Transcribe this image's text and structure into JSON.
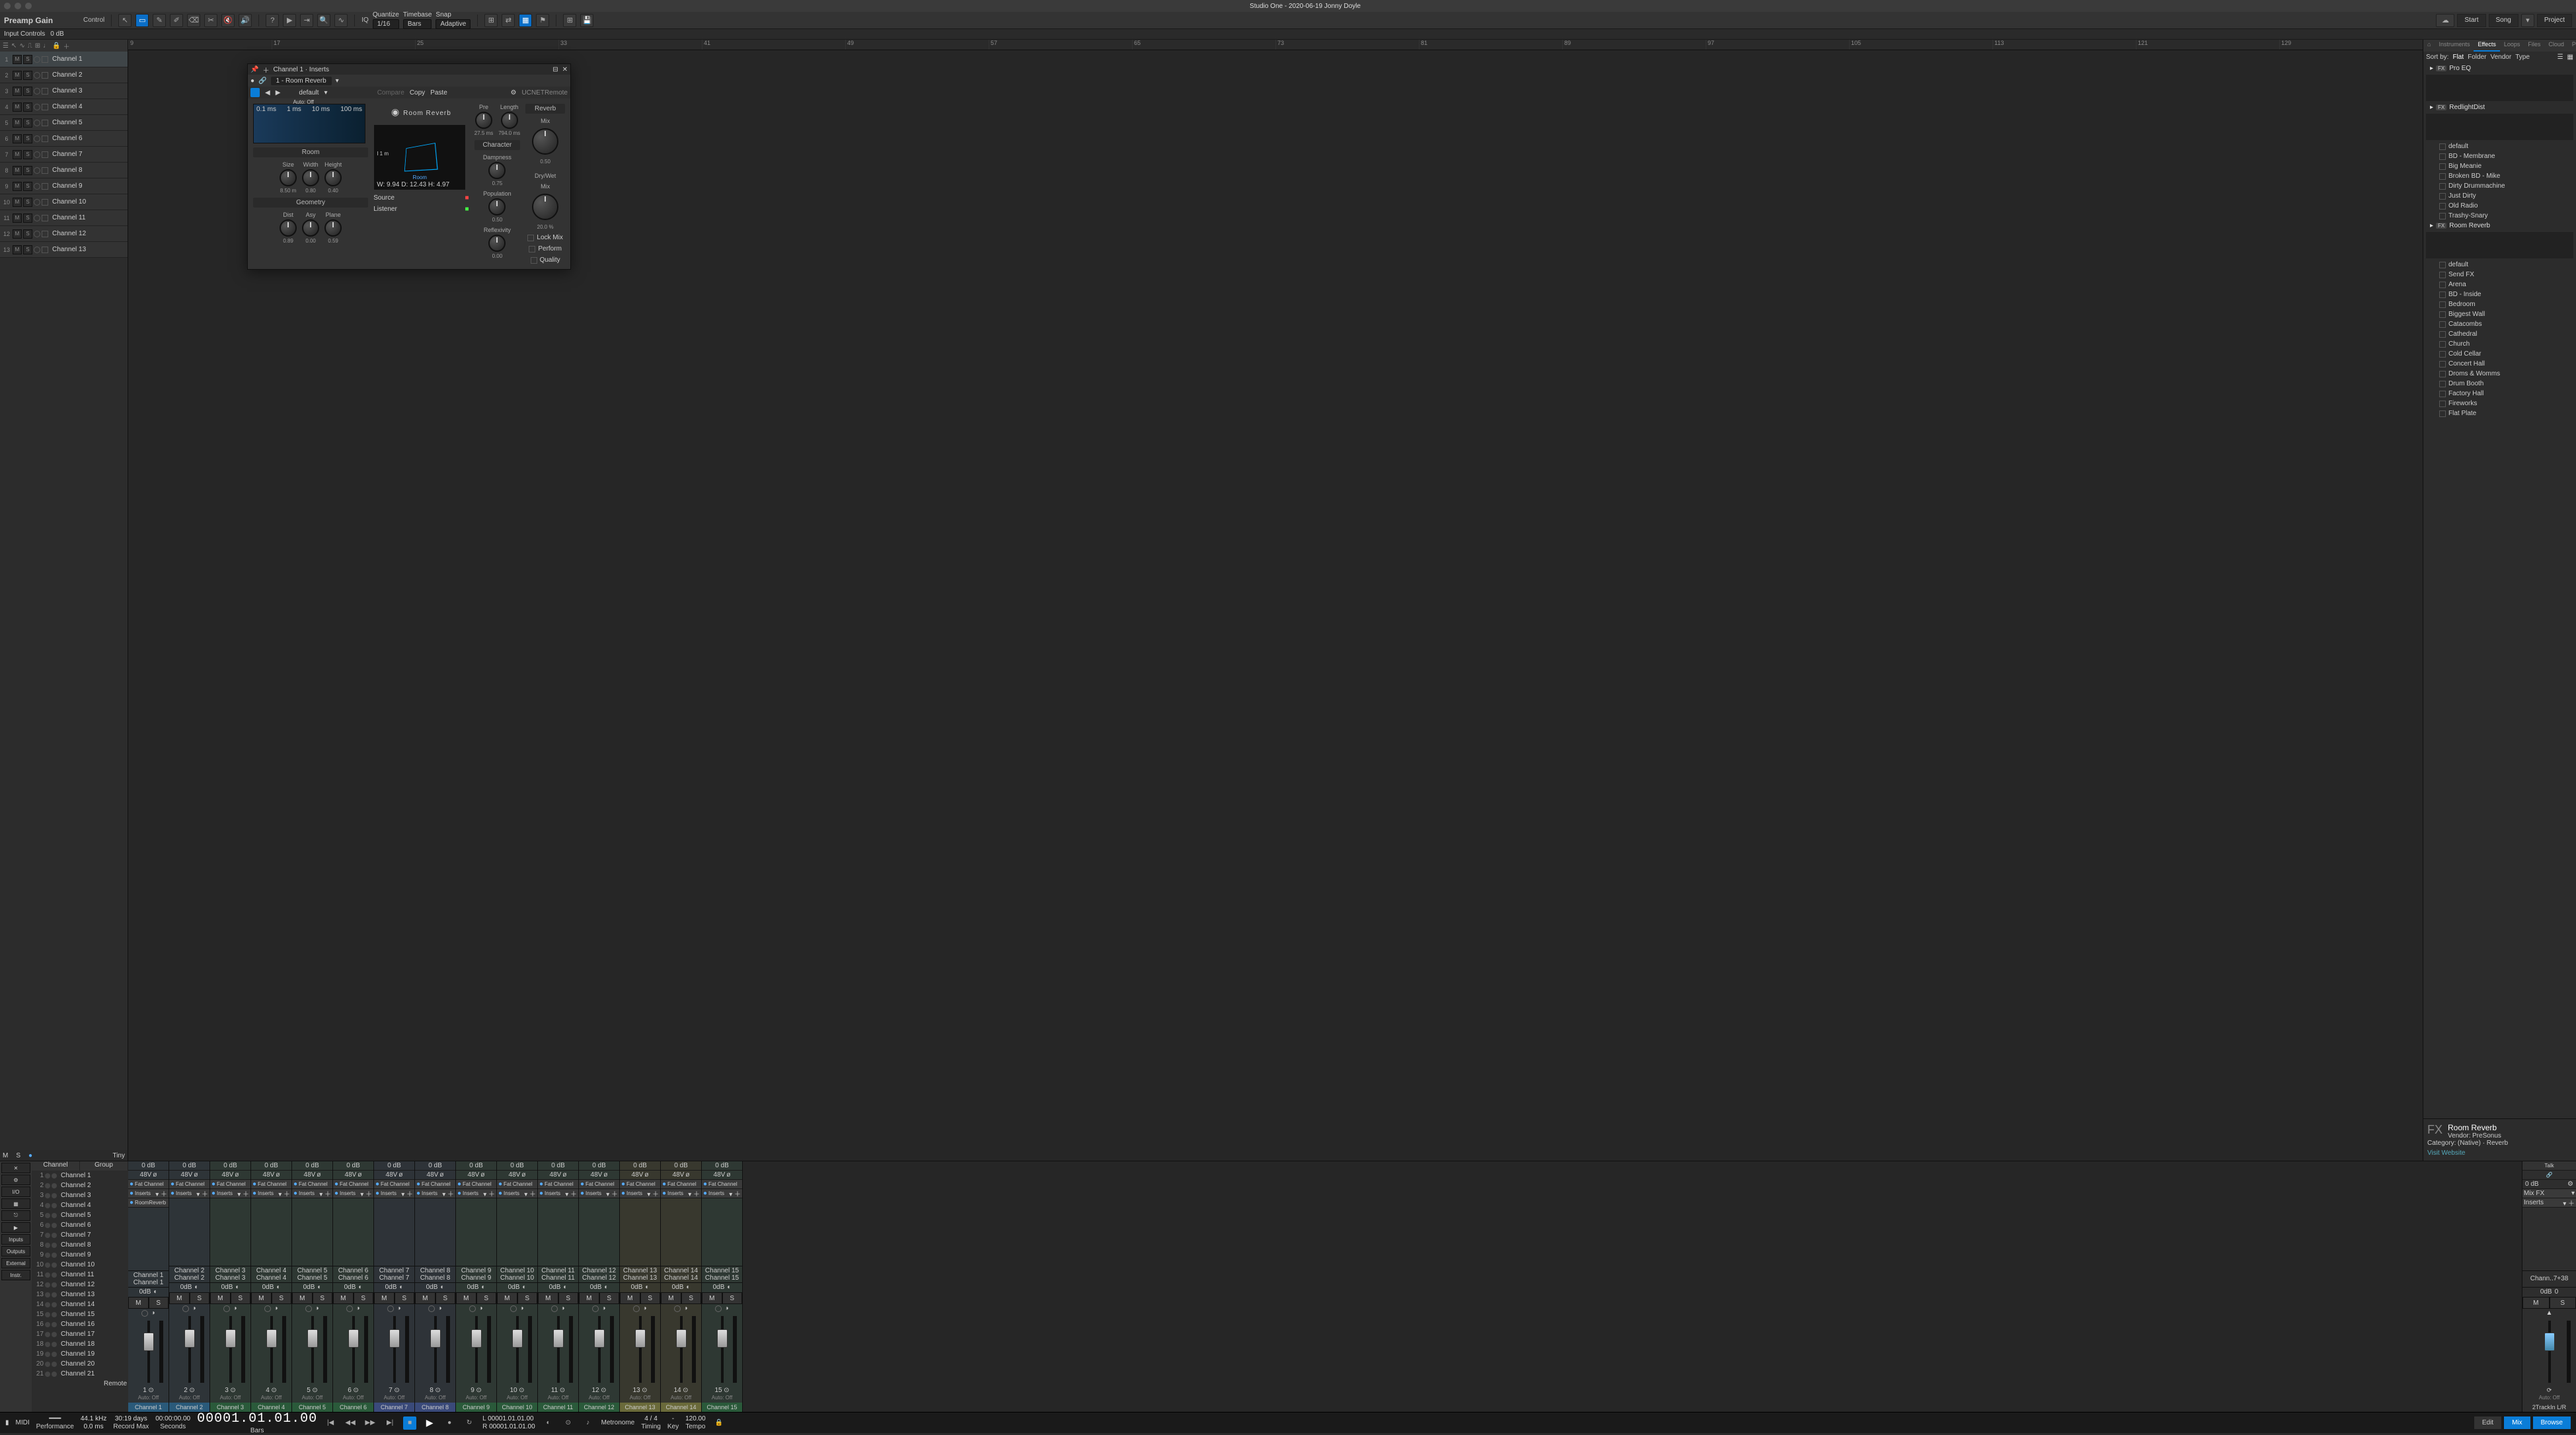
{
  "app": {
    "title": "Studio One - 2020-06-19 Jonny Doyle"
  },
  "toolbar": {
    "preamp_label": "Preamp Gain",
    "control_label": "Control",
    "input_label": "Input Controls",
    "input_value": "0 dB",
    "quantize_label": "Quantize",
    "quantize_value": "1/16",
    "timebase_label": "Timebase",
    "timebase_value": "Bars",
    "snap_label": "Snap",
    "snap_value": "Adaptive",
    "iq": "IQ",
    "start": "Start",
    "song": "Song",
    "project": "Project"
  },
  "ruler": [
    "9",
    "17",
    "25",
    "33",
    "41",
    "49",
    "57",
    "65",
    "73",
    "81",
    "89",
    "97",
    "105",
    "113",
    "121",
    "129"
  ],
  "tracks": [
    "Channel 1",
    "Channel 2",
    "Channel 3",
    "Channel 4",
    "Channel 5",
    "Channel 6",
    "Channel 7",
    "Channel 8",
    "Channel 9",
    "Channel 10",
    "Channel 11",
    "Channel 12",
    "Channel 13"
  ],
  "tracks_footer": {
    "m": "M",
    "s": "S",
    "size": "Tiny"
  },
  "plugin": {
    "header": "Channel 1 · Inserts",
    "preset": "1 - Room Reverb",
    "default": "default",
    "copy": "Copy",
    "paste": "Paste",
    "compare": "Compare",
    "auto": "Auto: Off",
    "remote": "UCNETRemote",
    "logo": "Room Reverb",
    "graph_labels": [
      "0.1 ms",
      "1 ms",
      "10 ms",
      "100 ms"
    ],
    "section_room": "Room",
    "room_size_label": "Size",
    "room_size": "8.50 m",
    "room_width_label": "Width",
    "room_width": "0.80",
    "room_height_label": "Height",
    "room_height": "0.40",
    "section_geom": "Geometry",
    "geom_dist_label": "Dist",
    "geom_dist": "0.89",
    "geom_asy_label": "Asy",
    "geom_asy": "0.00",
    "geom_plane_label": "Plane",
    "geom_plane": "0.59",
    "room3d_label": "Room",
    "room3d_I": "I 1 m",
    "room3d_info": "W: 9.94  D: 12.43  H: 4.97",
    "source": "Source",
    "listener": "Listener",
    "pre_label": "Pre",
    "pre": "27.5 ms",
    "length_label": "Length",
    "length": "794.0 ms",
    "character": "Character",
    "damp_label": "Dampness",
    "damp": "0.75",
    "pop_label": "Population",
    "pop": "0.50",
    "reflex_label": "Reflexivity",
    "reflex": "0.00",
    "reverb": "Reverb",
    "mix": "Mix",
    "reverb_mix": "0.50",
    "drywet": "Dry/Wet",
    "drywet_mix": "20.0 %",
    "lockmix": "Lock Mix",
    "perform": "Perform",
    "quality": "Quality"
  },
  "browser": {
    "tabs": [
      "Instruments",
      "Effects",
      "Loops",
      "Files",
      "Cloud",
      "Pool"
    ],
    "sort_label": "Sort by:",
    "sort_opts": [
      "Flat",
      "Folder",
      "Vendor",
      "Type"
    ],
    "fx_proeq": "Pro EQ",
    "fx_redlight": "RedlightDist",
    "redlight_presets": [
      "default",
      "BD - Membrane",
      "Big Meanie",
      "Broken BD - Mike",
      "Dirty Drummachine",
      "Just Dirty",
      "Old Radio",
      "Trashy-Snary"
    ],
    "fx_roomreverb": "Room Reverb",
    "roomreverb_presets": [
      "default",
      "Send FX",
      "Arena",
      "BD - Inside",
      "Bedroom",
      "Biggest Wall",
      "Catacombs",
      "Cathedral",
      "Church",
      "Cold Cellar",
      "Concert Hall",
      "Droms & Womms",
      "Drum Booth",
      "Factory Hall",
      "Fireworks",
      "Flat Plate"
    ],
    "info_name": "Room Reverb",
    "info_vendor_label": "Vendor:",
    "info_vendor": "PreSonus",
    "info_cat_label": "Category:",
    "info_cat": "(Native) · Reverb",
    "info_link": "Visit Website",
    "home": "⌂"
  },
  "mixer": {
    "chanlist_hdr": [
      "Channel",
      "Group"
    ],
    "tools": [
      "✕",
      "⚙",
      "I/O",
      "▦",
      "⎋",
      "▶",
      "Inputs",
      "Outputs",
      "External",
      "Instr."
    ],
    "remote": "Remote",
    "channels": [
      "Channel 1",
      "Channel 2",
      "Channel 3",
      "Channel 4",
      "Channel 5",
      "Channel 6",
      "Channel 7",
      "Channel 8",
      "Channel 9",
      "Channel 10",
      "Channel 11",
      "Channel 12",
      "Channel 13",
      "Channel 14",
      "Channel 15",
      "Channel 16",
      "Channel 17",
      "Channel 18",
      "Channel 19",
      "Channel 20",
      "Channel 21"
    ],
    "strip": {
      "db": "0 dB",
      "v48": "48V",
      "phase": "ø",
      "fat": "Fat Channel",
      "inserts": "Inserts",
      "roomrev": "RoomReverb",
      "pan": "0dB",
      "m": "M",
      "s": "S",
      "auto": "Auto: Off"
    },
    "master": {
      "talk": "Talk",
      "mixfx": "Mix FX",
      "inserts": "Inserts",
      "name": "Chann..7+38",
      "db": "0 dB",
      "zero": "0",
      "out": "2TrackIn L/R"
    }
  },
  "transport": {
    "midi": "MIDI",
    "perf": "Performance",
    "sr": "44.1 kHz",
    "lat": "0.0 ms",
    "rectime": "30:19 days",
    "rectime_lbl": "Record Max",
    "pos_sec": "00:00:00.00",
    "pos_sec_lbl": "Seconds",
    "bigtime": "00001.01.01.00",
    "bigtime_lbl": "Bars",
    "loop_l": "00001.01.01.00",
    "loop_r": "00001.01.01.00",
    "l": "L",
    "r": "R",
    "metro": "Metronome",
    "sig": "4 / 4",
    "sig_lbl": "Timing",
    "key": "-",
    "key_lbl": "Key",
    "tempo": "120.00",
    "tempo_lbl": "Tempo",
    "edit": "Edit",
    "mix_btn": "Mix",
    "browse": "Browse"
  }
}
